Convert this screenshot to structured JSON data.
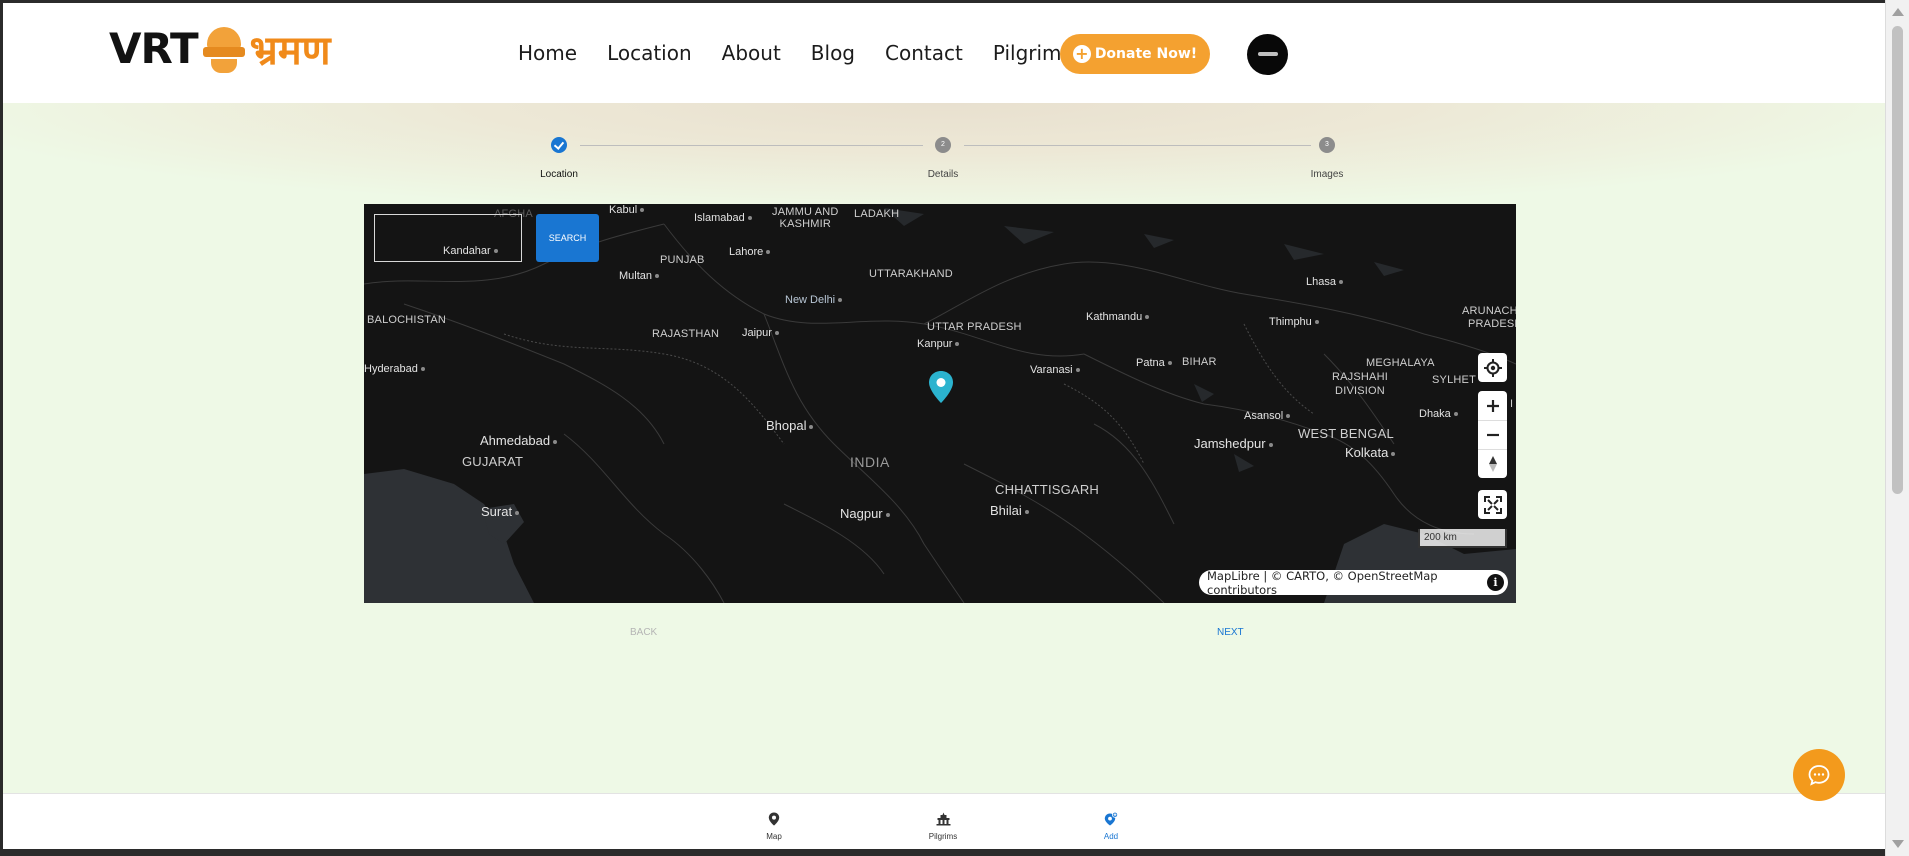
{
  "brand": {
    "logo_latin": "VRT",
    "logo_hindi": "भ्रमण"
  },
  "nav": {
    "home": "Home",
    "location": "Location",
    "about": "About",
    "blog": "Blog",
    "contact": "Contact",
    "pilgrimages": "Pilgrimages",
    "donate": "Donate Now!"
  },
  "stepper": {
    "steps": [
      {
        "label": "Location",
        "number": "1",
        "status": "completed"
      },
      {
        "label": "Details",
        "number": "2",
        "status": "pending"
      },
      {
        "label": "Images",
        "number": "3",
        "status": "pending"
      }
    ]
  },
  "map": {
    "search_value": "",
    "search_button": "SEARCH",
    "scale_label": "200 km",
    "attribution": "MapLibre | © CARTO, © OpenStreetMap contributors",
    "info_glyph": "i",
    "places": {
      "afghanistan_partial": "AFGHA",
      "kabul": "Kabul",
      "islamabad": "Islamabad",
      "jammu_kashmir_1": "JAMMU AND",
      "jammu_kashmir_2": "KASHMIR",
      "ladakh": "LADAKH",
      "kandahar": "Kandahar",
      "punjab": "PUNJAB",
      "lahore": "Lahore",
      "multan": "Multan",
      "uttarakhand": "UTTARAKHAND",
      "lhasa": "Lhasa",
      "new_delhi": "New Delhi",
      "balochistan": "BALOCHISTAN",
      "kathmandu": "Kathmandu",
      "thimphu": "Thimphu",
      "arunachal_1": "ARUNACHA",
      "arunachal_2": "PRADESH",
      "uttar_pradesh": "UTTAR PRADESH",
      "rajasthan": "RAJASTHAN",
      "jaipur": "Jaipur",
      "kanpur": "Kanpur",
      "hyderabad": "Hyderabad",
      "varanasi": "Varanasi",
      "patna": "Patna",
      "bihar": "BIHAR",
      "meghalaya": "MEGHALAYA",
      "rajshahi_1": "RAJSHAHI",
      "rajshahi_2": "DIVISION",
      "sylhet": "SYLHET",
      "sylhet_partial": "I",
      "dhaka": "Dhaka",
      "asansol": "Asansol",
      "ahmedabad": "Ahmedabad",
      "bhopal": "Bhopal",
      "gujarat": "GUJARAT",
      "india": "INDIA",
      "jamshedpur": "Jamshedpur",
      "west_bengal": "WEST BENGAL",
      "kolkata": "Kolkata",
      "chhattisgarh": "CHHATTISGARH",
      "surat": "Surat",
      "nagpur": "Nagpur",
      "bhilai": "Bhilai"
    }
  },
  "actions": {
    "back": "BACK",
    "next": "NEXT"
  },
  "bottom_nav": {
    "map": "Map",
    "pilgrims": "Pilgrims",
    "add": "Add"
  },
  "colors": {
    "accent_orange": "#f4a130",
    "primary_blue": "#1976d2",
    "background": "#eef9e6",
    "map_bg": "#141414",
    "marker": "#2bb3cf"
  },
  "icons": [
    "locate-icon",
    "zoom-in-icon",
    "zoom-out-icon",
    "compass-icon",
    "fullscreen-icon",
    "map-marker-icon",
    "chat-icon",
    "map-pin-icon",
    "temple-icon",
    "add-location-icon",
    "info-icon",
    "plus-icon"
  ]
}
